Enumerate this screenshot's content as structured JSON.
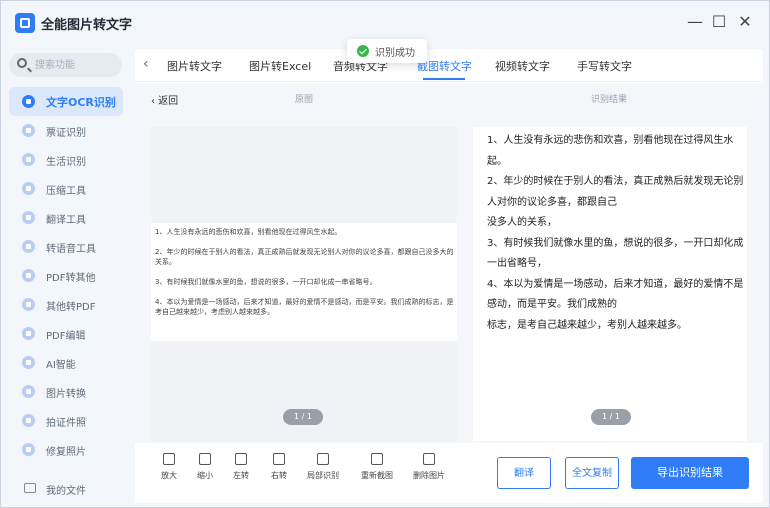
{
  "app": {
    "title": "全能图片转文字",
    "accent": "#2f7cf6"
  },
  "window_controls": {
    "minimize": "—",
    "maximize": "☐",
    "close": "✕"
  },
  "sidebar": {
    "search_placeholder": "搜索功能",
    "items": [
      {
        "label": "文字OCR识别",
        "icon": "ocr-icon",
        "active": true
      },
      {
        "label": "票证识别",
        "icon": "ticket-icon"
      },
      {
        "label": "生活识别",
        "icon": "life-icon"
      },
      {
        "label": "压缩工具",
        "icon": "compress-icon"
      },
      {
        "label": "翻译工具",
        "icon": "translate-icon"
      },
      {
        "label": "转语音工具",
        "icon": "voice-icon"
      },
      {
        "label": "PDF转其他",
        "icon": "pdf-icon"
      },
      {
        "label": "其他转PDF",
        "icon": "to-pdf-icon"
      },
      {
        "label": "PDF编辑",
        "icon": "pdf-edit-icon"
      },
      {
        "label": "AI智能",
        "icon": "ai-icon"
      },
      {
        "label": "图片转换",
        "icon": "image-convert-icon"
      },
      {
        "label": "拍证件照",
        "icon": "id-photo-icon"
      },
      {
        "label": "修复照片",
        "icon": "repair-photo-icon"
      }
    ],
    "bottom_label": "我的文件"
  },
  "tabs": {
    "back": "‹",
    "items": [
      "图片转文字",
      "图片转Excel",
      "音频转文字",
      "截图转文字",
      "视频转文字",
      "手写转文字"
    ],
    "active_index": 3
  },
  "toast": {
    "label": "识别成功",
    "color": "#39b54a"
  },
  "subheader": {
    "back_label": "‹ 返回",
    "left_title": "原图",
    "right_title": "识别结果"
  },
  "source_image": {
    "lines": [
      "1、人生没有永远的悲伤和欢喜，别看他现在过得风生水起。",
      "2、年少的时候在于别人的看法，真正成熟后就发现无论别人对你的议论多喜，都跟自己没多大的关系。",
      "3、有时候我们就像水里的鱼，想说的很多，一开口却化成一串省略号。",
      "4、本以为爱情是一场感动，后来才知道，最好的爱情不是感动，而是平安。我们成熟的标志，是考自己越来越少，考虑别人越来越多。"
    ],
    "pager": "1 / 1"
  },
  "result": {
    "lines": [
      "1、人生没有永远的悲伤和欢喜，别看他现在过得风生水",
      "起。",
      "2、年少的时候在于别人的看法，真正成熟后就发现无论别",
      "人对你的议论多喜，都跟自己",
      "没多人的关系，",
      "3、有时候我们就像水里的鱼，想说的很多，一开口却化成",
      "一出省略号，",
      "4、本以为爱情是一场感动，后来才知道，最好的爱情不是",
      "感动，而是平安。我们成熟的",
      "标志，是考自己越来越少，考别人越来越多。"
    ],
    "pager": "1 / 1"
  },
  "toolbar": {
    "tools": [
      {
        "label": "放大",
        "icon": "zoom-in-icon"
      },
      {
        "label": "缩小",
        "icon": "zoom-out-icon"
      },
      {
        "label": "左转",
        "icon": "rotate-left-icon"
      },
      {
        "label": "右转",
        "icon": "rotate-right-icon"
      },
      {
        "label": "局部识别",
        "icon": "partial-recognize-icon"
      },
      {
        "label": "重新截图",
        "icon": "rescreenshot-icon"
      },
      {
        "label": "删除图片",
        "icon": "delete-icon"
      }
    ],
    "translate": "翻译",
    "copy_all": "全文复制",
    "export": "导出识别结果"
  }
}
